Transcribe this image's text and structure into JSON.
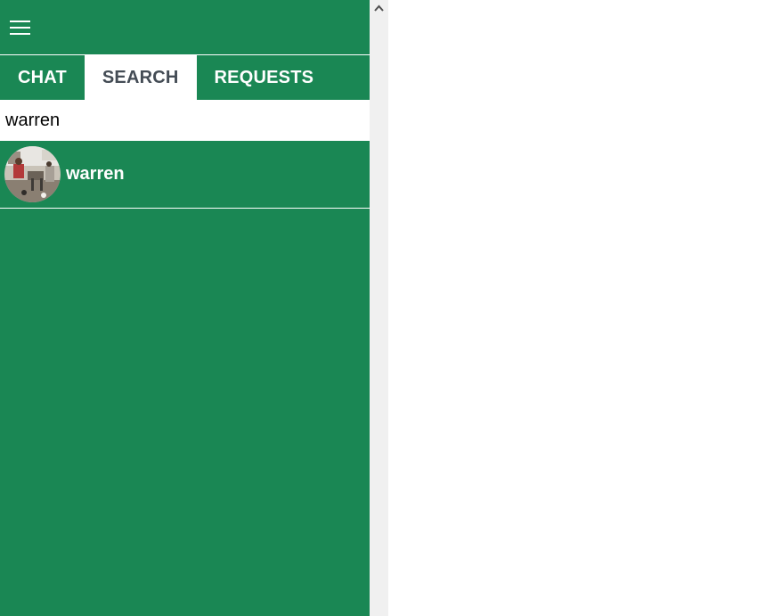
{
  "colors": {
    "sidebar_bg": "#1a8754",
    "active_tab_bg": "#ffffff",
    "active_tab_text": "#444c55",
    "scrollbar_bg": "#f0f0f0"
  },
  "header": {
    "menu_icon": "hamburger-menu-icon"
  },
  "tabs": [
    {
      "label": "CHAT",
      "active": false
    },
    {
      "label": "SEARCH",
      "active": true
    },
    {
      "label": "REQUESTS",
      "active": false
    }
  ],
  "search": {
    "value": "warren"
  },
  "results": [
    {
      "name": "warren",
      "avatar_icon": "user-avatar-photo"
    }
  ],
  "scrollbar": {
    "up_icon": "chevron-up-icon"
  }
}
